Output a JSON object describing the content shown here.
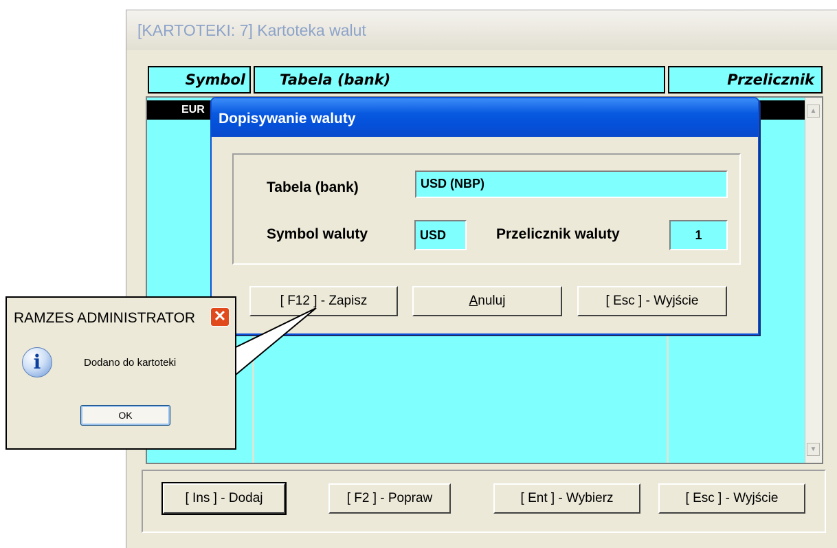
{
  "main_window": {
    "title": "[KARTOTEKI: 7]  Kartoteka walut"
  },
  "table": {
    "headers": [
      "Symbol",
      "Tabela (bank)",
      "Przelicznik"
    ],
    "selected_row": {
      "symbol": "EUR"
    }
  },
  "bottom_buttons": [
    {
      "label": "[ Ins ] - Dodaj"
    },
    {
      "label": "[ F2 ] - Popraw"
    },
    {
      "label": "[ Ent ] - Wybierz"
    },
    {
      "label": "[ Esc ] - Wyjście"
    }
  ],
  "dialog": {
    "title": "Dopisywanie waluty",
    "tabela_label": "Tabela (bank)",
    "tabela_value": "USD (NBP)",
    "symbol_label": "Symbol waluty",
    "symbol_value": "USD",
    "przelicznik_label": "Przelicznik waluty",
    "przelicznik_value": "1",
    "buttons": {
      "save": "[ F12 ] - Zapisz",
      "cancel_prefix": "A",
      "cancel_rest": "nuluj",
      "exit": "[ Esc ] - Wyjście"
    }
  },
  "message_box": {
    "title": "RAMZES ADMINISTRATOR",
    "text": "Dodano do kartoteki",
    "ok_label": "OK",
    "icon": "info-icon"
  }
}
